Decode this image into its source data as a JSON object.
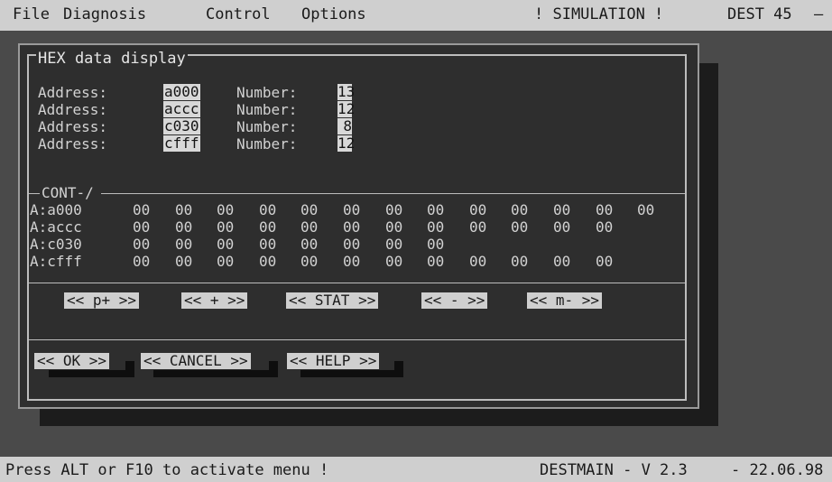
{
  "menu": {
    "items": [
      "File",
      "Diagnosis",
      "Control",
      "Options"
    ],
    "mode": "! SIMULATION !",
    "device": "DEST 45",
    "dash": "—"
  },
  "dialog": {
    "title": "HEX data display",
    "address_label": "Address:",
    "number_label": "Number:",
    "entries": [
      {
        "address": "a000",
        "number": "13"
      },
      {
        "address": "accc",
        "number": "12"
      },
      {
        "address": "c030",
        "number": "8"
      },
      {
        "address": "cfff",
        "number": "12"
      }
    ],
    "cont_label": "CONT-/",
    "rows": [
      {
        "label": "A:a000",
        "values": [
          "00",
          "00",
          "00",
          "00",
          "00",
          "00",
          "00",
          "00",
          "00",
          "00",
          "00",
          "00",
          "00"
        ]
      },
      {
        "label": "A:accc",
        "values": [
          "00",
          "00",
          "00",
          "00",
          "00",
          "00",
          "00",
          "00",
          "00",
          "00",
          "00",
          "00"
        ]
      },
      {
        "label": "A:c030",
        "values": [
          "00",
          "00",
          "00",
          "00",
          "00",
          "00",
          "00",
          "00"
        ]
      },
      {
        "label": "A:cfff",
        "values": [
          "00",
          "00",
          "00",
          "00",
          "00",
          "00",
          "00",
          "00",
          "00",
          "00",
          "00",
          "00"
        ]
      }
    ],
    "nav_buttons": [
      "<< p+ >>",
      "<< + >>",
      "<< STAT >>",
      "<< - >>",
      "<< m- >>"
    ],
    "action_buttons": [
      "<< OK >>",
      "<< CANCEL >>",
      "<< HELP >>"
    ]
  },
  "status": {
    "hint": "Press ALT or F10 to activate menu !",
    "program": "DESTMAIN - V 2.3",
    "date": "- 22.06.98"
  }
}
